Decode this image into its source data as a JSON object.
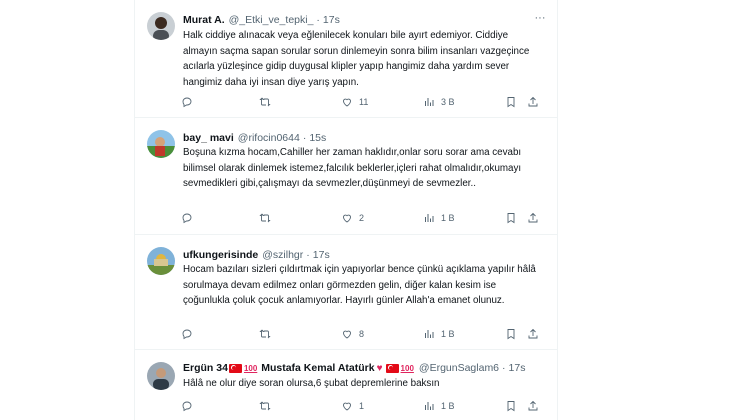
{
  "tweets": [
    {
      "name": "Murat A.",
      "handle": "@_Etki_ve_tepki_",
      "sep": "·",
      "time": "17s",
      "text": "Halk ciddiye alınacak veya eğlenilecek konuları bile ayırt edemiyor. Ciddiye almayın saçma sapan sorular sorun dinlemeyin sonra bilim insanları vazgeçince acılarla yüzleşince gidip duygusal klipler yapıp hangimiz daha yardım sever hangimiz daha iyi insan diye yarış yapın.",
      "replies": "",
      "retweets": "",
      "likes": "11",
      "views": "3 B"
    },
    {
      "name": "bay_ mavi",
      "handle": "@rifocin0644",
      "sep": "·",
      "time": "15s",
      "text": "Boşuna kızma hocam,Cahiller her zaman haklıdır,onlar soru sorar ama cevabı bilimsel olarak dinlemek istemez,falcılık beklerler,içleri rahat olmalıdır,okumayı sevmedikleri gibi,çalışmayı da sevmezler,düşünmeyi de sevmezler..",
      "replies": "",
      "retweets": "",
      "likes": "2",
      "views": "1 B"
    },
    {
      "name": "ufkungerisinde",
      "handle": "@szilhgr",
      "sep": "·",
      "time": "17s",
      "text": "Hocam bazıları sizleri çıldırtmak için yapıyorlar bence çünkü açıklama yapılır hâlâ sorulmaya devam edilmez onları görmezden gelin, diğer kalan kesim ise çoğunlukla çoluk çocuk anlamıyorlar. Hayırlı günler Allah'a emanet olunuz.",
      "replies": "",
      "retweets": "",
      "likes": "8",
      "views": "1 B"
    },
    {
      "name_part1": "Ergün 34",
      "name_part2": "Mustafa Kemal Atatürk",
      "emoji_100": "100",
      "handle": "@ErgunSaglam6",
      "sep": "·",
      "time": "17s",
      "text": "Hâlâ ne olur diye soran olursa,6 şubat depremlerine baksın",
      "replies": "",
      "retweets": "",
      "likes": "1",
      "views": "1 B"
    }
  ],
  "icons": {
    "more": "more-dots-icon",
    "reply": "reply-icon",
    "retweet": "retweet-icon",
    "like": "heart-icon",
    "views": "views-icon",
    "bookmark": "bookmark-icon",
    "share": "share-icon"
  },
  "colors": {
    "text": "#0f1419",
    "secondary": "#536471",
    "border": "#eff3f4",
    "flag_red": "#e30a17",
    "emoji_red": "#e0245e"
  }
}
